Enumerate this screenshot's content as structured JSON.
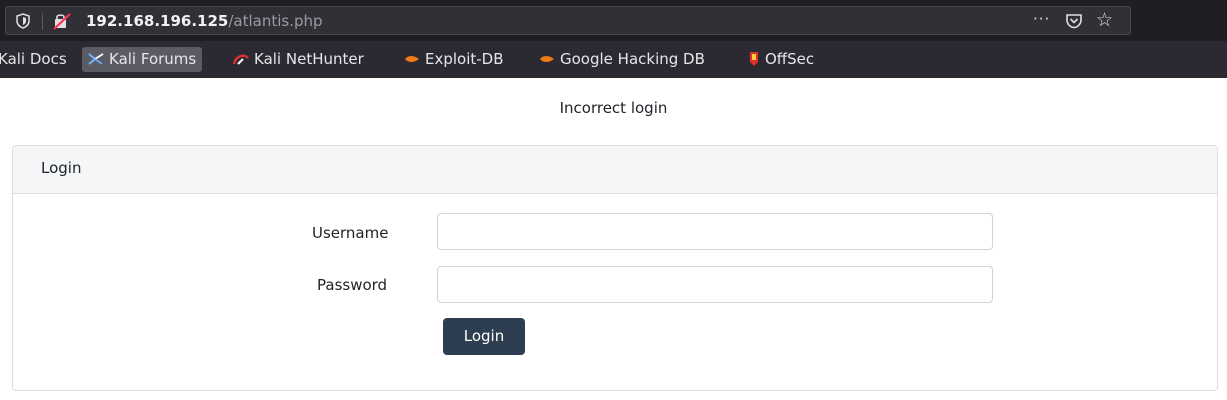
{
  "browser": {
    "url_host": "192.168.196.125",
    "url_path": "/atlantis.php",
    "more_icon": "···",
    "star_icon": "☆"
  },
  "bookmarks": [
    {
      "label": "Kali Docs",
      "icon": "none"
    },
    {
      "label": "Kali Forums",
      "icon": "kali-forums-icon"
    },
    {
      "label": "Kali NetHunter",
      "icon": "nethunter-icon"
    },
    {
      "label": "Exploit-DB",
      "icon": "exploit-db-icon"
    },
    {
      "label": "Google Hacking DB",
      "icon": "exploit-db-icon"
    },
    {
      "label": "OffSec",
      "icon": "offsec-icon"
    }
  ],
  "page": {
    "message": "Incorrect login",
    "card_title": "Login",
    "username_label": "Username",
    "username_value": "",
    "password_label": "Password",
    "password_value": "",
    "login_button": "Login"
  },
  "colors": {
    "toolbar": "#1f1f23",
    "bookmark_bar": "#2b2a33",
    "button": "#2c3e50",
    "card_header": "#f5f6f7"
  }
}
